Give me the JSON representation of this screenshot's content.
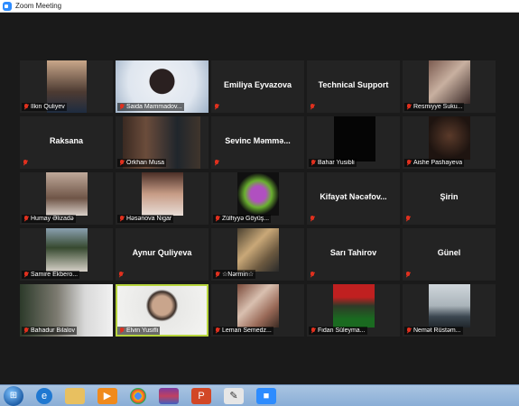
{
  "window": {
    "title": "Zoom Meeting"
  },
  "participants": [
    {
      "name": "İlkin Quliyev",
      "video": true
    },
    {
      "name": "Saida Mammadov...",
      "video": true
    },
    {
      "name": "Emiliya Eyvazova",
      "video": false
    },
    {
      "name": "Technical Support",
      "video": false
    },
    {
      "name": "Resmiyye Suku...",
      "video": true
    },
    {
      "name": "Raksana",
      "video": false
    },
    {
      "name": "Orkhan Musa",
      "video": true
    },
    {
      "name": "Sevinc Məmmə...",
      "video": false
    },
    {
      "name": "Bahar Yusibli",
      "video": true
    },
    {
      "name": "Aishe Pashayeva",
      "video": true
    },
    {
      "name": "Humay Əlizadə",
      "video": true
    },
    {
      "name": "Həsənova Nigar",
      "video": true
    },
    {
      "name": "Zülfiyyə Göyüş...",
      "video": true
    },
    {
      "name": "Kifayət Nəcəfov...",
      "video": false
    },
    {
      "name": "Şirin",
      "video": false
    },
    {
      "name": "Samire Ekbero...",
      "video": true
    },
    {
      "name": "Aynur Quliyeva",
      "video": false
    },
    {
      "name": "☆Nərmin☆",
      "video": true
    },
    {
      "name": "Sarı Tahirov",
      "video": false
    },
    {
      "name": "Günel",
      "video": false
    },
    {
      "name": "Bahadur Bilalov",
      "video": true
    },
    {
      "name": "Elvin Yusifli",
      "video": true,
      "active": true
    },
    {
      "name": "Leman Semedz...",
      "video": true
    },
    {
      "name": "Fidan Süleyma...",
      "video": true
    },
    {
      "name": "Nemət Rüstəm...",
      "video": true
    }
  ],
  "taskbar": {
    "items": [
      "start-button",
      "internet-explorer-icon",
      "file-explorer-icon",
      "media-player-icon",
      "chrome-icon",
      "winrar-icon",
      "powerpoint-icon",
      "paint-icon",
      "zoom-icon"
    ]
  },
  "colors": {
    "active_speaker": "#b6d43c",
    "muted": "#e0301e",
    "tile_bg": "#232323"
  }
}
